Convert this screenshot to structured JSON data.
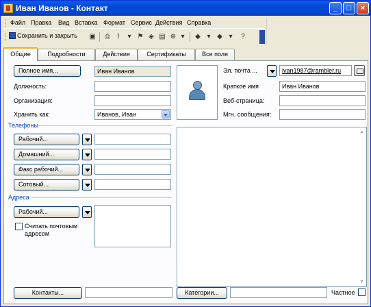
{
  "window": {
    "title": "Иван Иванов - Контакт"
  },
  "menu": {
    "items": [
      "Файл",
      "Правка",
      "Вид",
      "Вставка",
      "Формат",
      "Сервис",
      "Действия",
      "Справка"
    ]
  },
  "toolbar": {
    "save_close": "Сохранить и закрыть"
  },
  "tabs": [
    "Общие",
    "Подробности",
    "Действия",
    "Сертификаты",
    "Все поля"
  ],
  "form": {
    "full_name_btn": "Полное имя...",
    "full_name_value": "Иван Иванов",
    "job_title_label": "Должность:",
    "job_title_value": "",
    "company_label": "Организация:",
    "company_value": "",
    "file_as_label": "Хранить как:",
    "file_as_value": "Иванов, Иван"
  },
  "phones": {
    "title": "Телефоны",
    "buttons": [
      "Рабочий...",
      "Домашний...",
      "Факс рабочий...",
      "Сотовый..."
    ]
  },
  "addresses": {
    "title": "Адреса",
    "button": "Рабочий...",
    "mailing_label": "Считать почтовым адресом"
  },
  "contact": {
    "email_btn": "Эл. почта ...",
    "email_value": "ivan1987@rambler.ru",
    "display_as_label": "Краткое имя",
    "display_as_value": "Иван Иванов",
    "webpage_label": "Веб-страница:",
    "im_label": "Мгн. сообщения:"
  },
  "footer": {
    "contacts_btn": "Контакты...",
    "categories_btn": "Категории...",
    "private_label": "Частное"
  }
}
